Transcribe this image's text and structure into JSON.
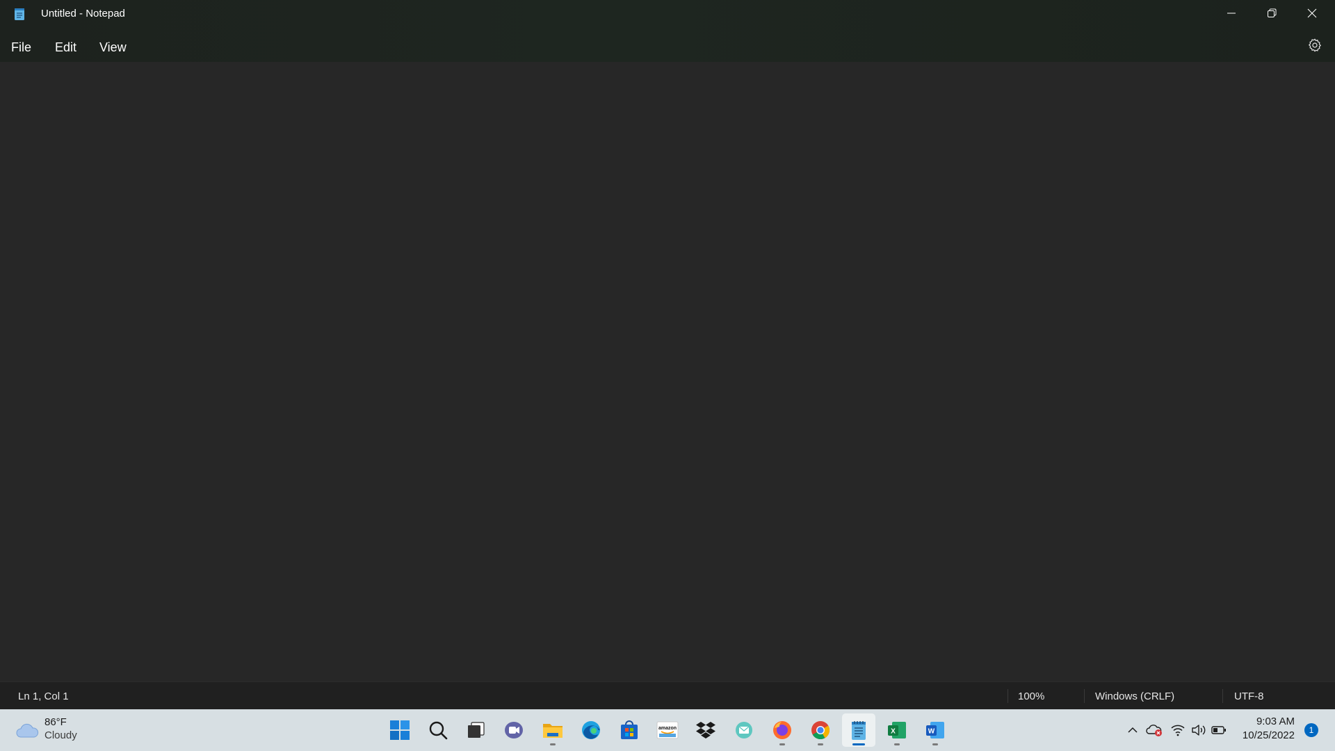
{
  "window": {
    "title": "Untitled - Notepad",
    "controls": [
      "minimize",
      "restore",
      "close"
    ]
  },
  "menu": {
    "file_label": "File",
    "edit_label": "Edit",
    "view_label": "View"
  },
  "editor": {
    "content": ""
  },
  "status": {
    "position": "Ln 1, Col 1",
    "zoom": "100%",
    "line_ending": "Windows (CRLF)",
    "encoding": "UTF-8"
  },
  "taskbar": {
    "weather": {
      "temperature": "86°F",
      "condition": "Cloudy"
    },
    "apps": [
      {
        "name": "start",
        "icon": "windows-logo-icon",
        "running": false
      },
      {
        "name": "search",
        "icon": "search-icon",
        "running": false
      },
      {
        "name": "task-view",
        "icon": "task-view-icon",
        "running": false
      },
      {
        "name": "teams-chat",
        "icon": "teams-chat-icon",
        "running": false
      },
      {
        "name": "file-explorer",
        "icon": "folder-icon",
        "running": true
      },
      {
        "name": "edge",
        "icon": "edge-icon",
        "running": false
      },
      {
        "name": "microsoft-store",
        "icon": "store-icon",
        "running": false
      },
      {
        "name": "amazon",
        "icon": "amazon-icon",
        "running": false
      },
      {
        "name": "dropbox",
        "icon": "dropbox-icon",
        "running": false
      },
      {
        "name": "mail",
        "icon": "mail-icon",
        "running": false
      },
      {
        "name": "firefox",
        "icon": "firefox-icon",
        "running": true
      },
      {
        "name": "chrome",
        "icon": "chrome-icon",
        "running": true
      },
      {
        "name": "notepad",
        "icon": "notepad-icon",
        "running": true,
        "active": true
      },
      {
        "name": "excel",
        "icon": "excel-icon",
        "running": true
      },
      {
        "name": "word",
        "icon": "word-icon",
        "running": true
      }
    ],
    "amazon_label": "amazon",
    "excel_letter": "X",
    "word_letter": "W",
    "clock": {
      "time": "9:03 AM",
      "date": "10/25/2022"
    },
    "notification_count": "1"
  },
  "colors": {
    "editor_bg": "#272727",
    "chrome_bg": "#1e2620",
    "statusbar_bg": "#202020",
    "taskbar_bg": "#d7dfe3",
    "accent": "#0067c0"
  }
}
